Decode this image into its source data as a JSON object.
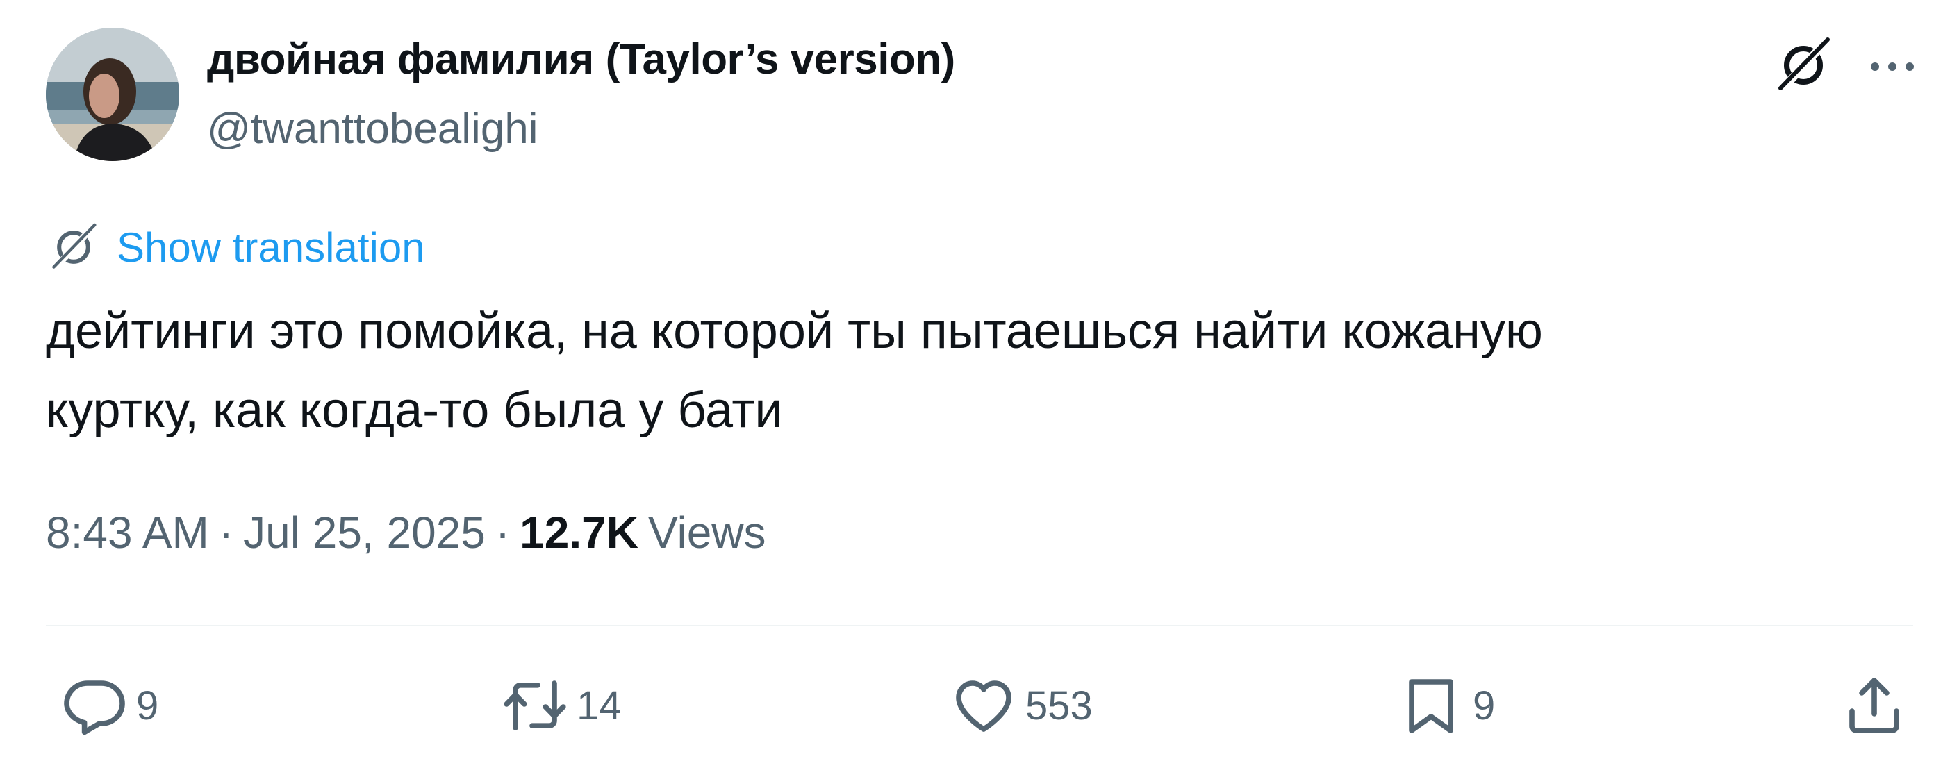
{
  "author": {
    "display_name": "двойная фамилия (Taylor’s version)",
    "handle": "@twanttobealighi"
  },
  "icons": {
    "grok": "grok-icon",
    "more": "more-dots-icon",
    "translate": "translate-icon",
    "reply": "reply-icon",
    "retweet": "retweet-icon",
    "like": "heart-icon",
    "bookmark": "bookmark-icon",
    "share": "share-icon"
  },
  "translation": {
    "label": "Show translation"
  },
  "tweet": {
    "lines": [
      "дейтинги это помойка, на которой ты пытаешься найти кожаную",
      "куртку, как когда-то была у бати"
    ]
  },
  "meta": {
    "time": "8:43 AM",
    "separator": "·",
    "date": "Jul 25, 2025",
    "views_count": "12.7K",
    "views_label": "Views"
  },
  "actions": {
    "replies": "9",
    "reposts": "14",
    "likes": "553",
    "bookmarks": "9"
  },
  "colors": {
    "text_primary": "#0f1419",
    "text_secondary": "#536471",
    "link": "#1d9bf0",
    "divider": "#eff3f4"
  }
}
